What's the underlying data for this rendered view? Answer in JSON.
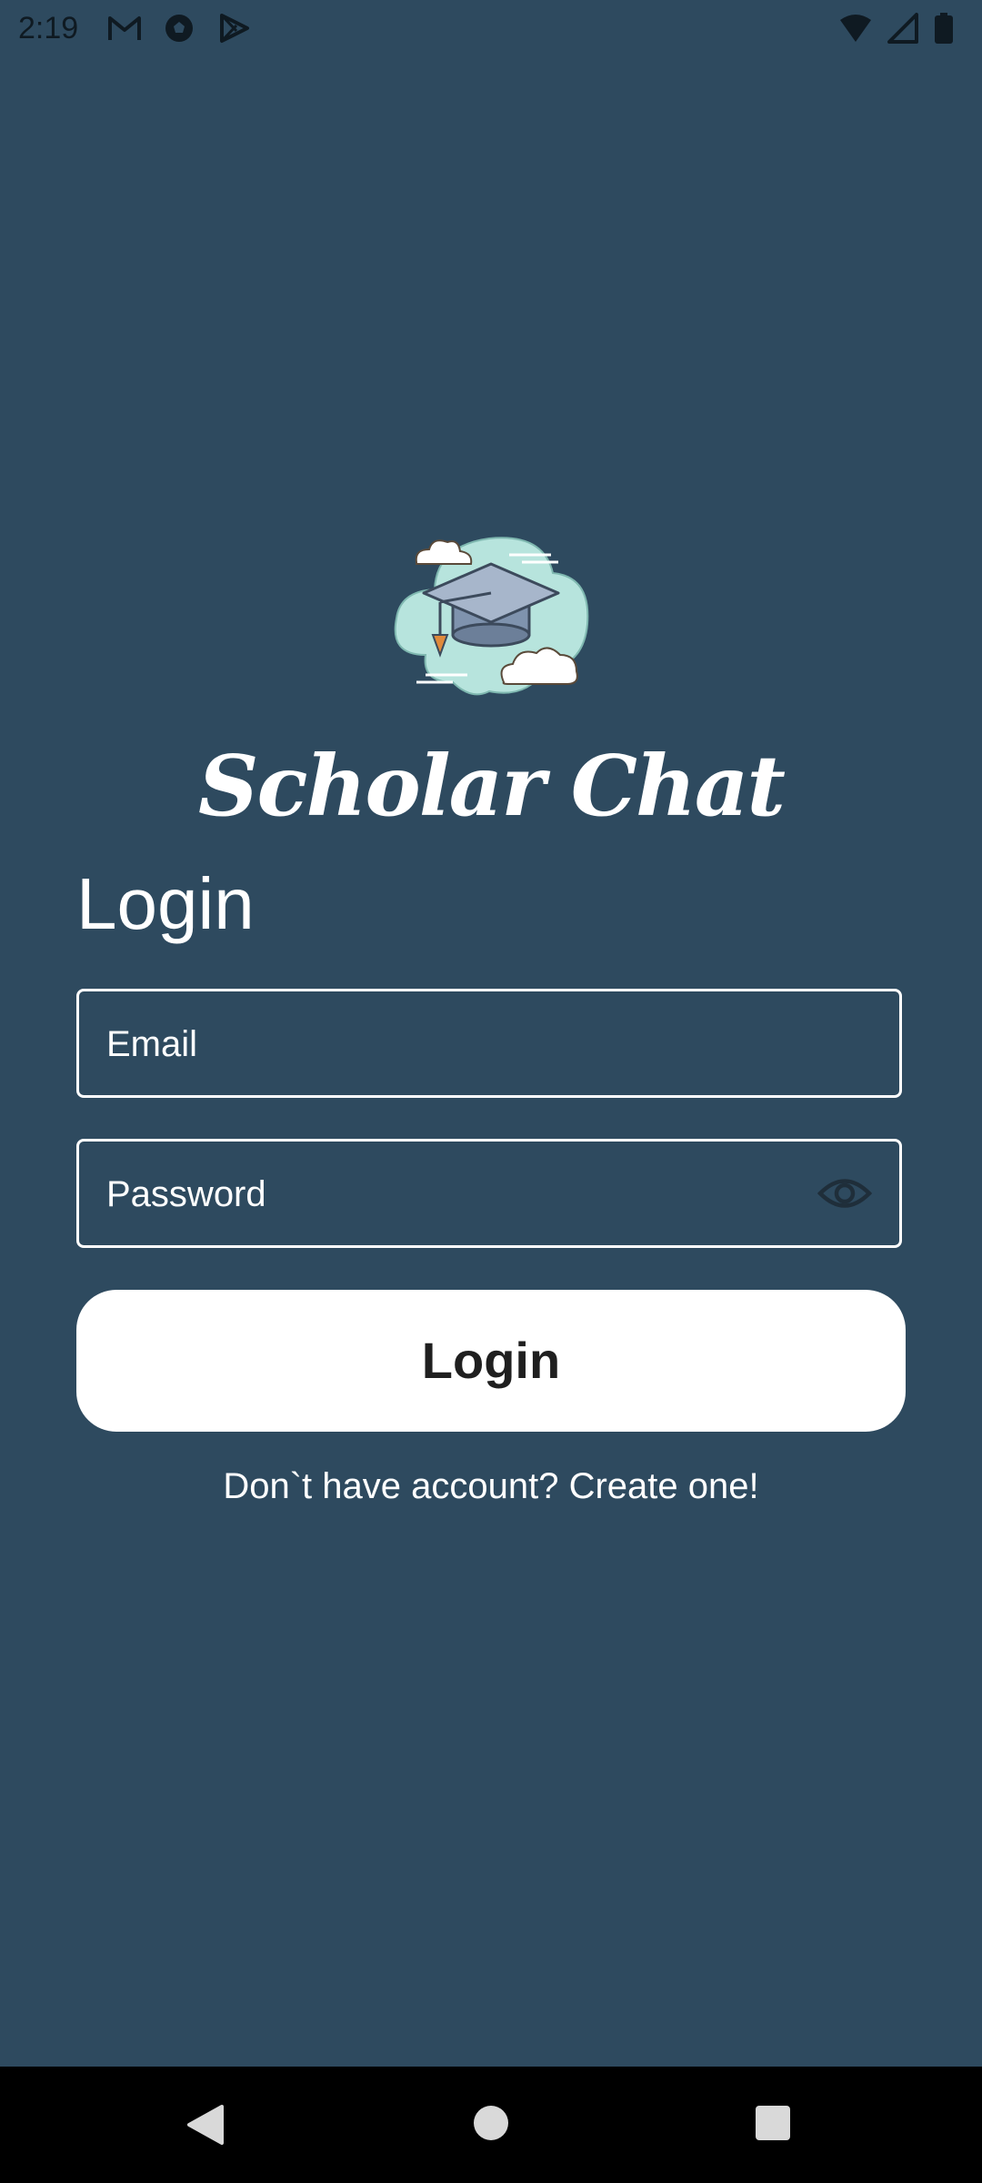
{
  "status_bar": {
    "time": "2:19",
    "left_icons": [
      "gmail-icon",
      "soccer-ball-icon",
      "play-store-icon"
    ],
    "right_icons": [
      "wifi-icon",
      "cell-signal-icon",
      "battery-icon"
    ]
  },
  "logo": {
    "icon": "graduation-cap-cloud-icon"
  },
  "app": {
    "title": "Scholar Chat"
  },
  "form": {
    "heading": "Login",
    "email_placeholder": "Email",
    "password_placeholder": "Password",
    "password_toggle_icon": "eye-icon",
    "submit_label": "Login",
    "signup_text": "Don`t have account? Create one!"
  },
  "nav_bar": {
    "icons": [
      "back-icon",
      "home-icon",
      "recents-icon"
    ]
  },
  "colors": {
    "background": "#2E4A5F",
    "text": "#FFFFFF",
    "button_bg": "#FFFFFF",
    "button_text": "#1F1F1F",
    "nav_bg": "#000000"
  }
}
